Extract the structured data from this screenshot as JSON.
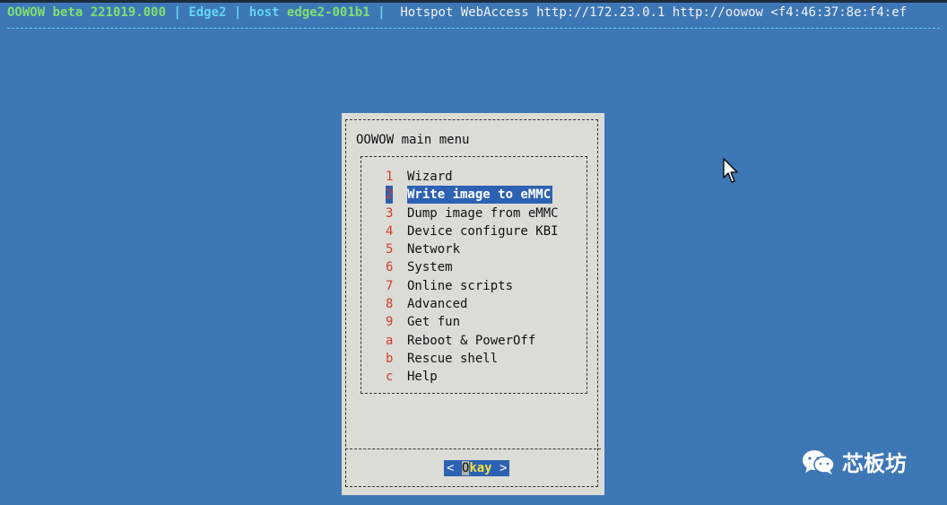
{
  "header": {
    "app_name": "OOWOW beta 221019.000",
    "separator": " | ",
    "device": "Edge2",
    "host_label": "host",
    "host": "edge2-001b1",
    "hotspot_info": " Hotspot WebAccess http://172.23.0.1 http://oowow <f4:46:37:8e:f4:ef"
  },
  "dialog": {
    "title": "OOWOW main menu",
    "selected_index": 1,
    "items": [
      {
        "key": "1",
        "label": "Wizard"
      },
      {
        "key": "2",
        "label": "Write image to eMMC"
      },
      {
        "key": "3",
        "label": "Dump image from eMMC"
      },
      {
        "key": "4",
        "label": "Device configure KBI"
      },
      {
        "key": "5",
        "label": "Network"
      },
      {
        "key": "6",
        "label": "System"
      },
      {
        "key": "7",
        "label": "Online scripts"
      },
      {
        "key": "8",
        "label": "Advanced"
      },
      {
        "key": "9",
        "label": "Get fun"
      },
      {
        "key": "a",
        "label": "Reboot & PowerOff"
      },
      {
        "key": "b",
        "label": "Rescue shell"
      },
      {
        "key": "c",
        "label": "Help"
      }
    ],
    "button": {
      "left_arrow": "<",
      "first_letter": "O",
      "rest": "kay",
      "right_arrow": ">"
    }
  },
  "watermark": {
    "text": "芯板坊",
    "icon": "wechat-icon"
  },
  "colors": {
    "background": "#3e77b6",
    "dialog": "#dcdcd6",
    "highlight": "#2c61b3",
    "hotkey": "#d83a2a",
    "header_green": "#7ee070",
    "header_cyan": "#63d6f0"
  }
}
